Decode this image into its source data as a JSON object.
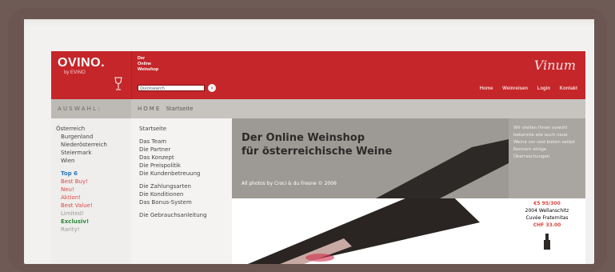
{
  "logo": {
    "main": "OVINO.",
    "sub": "by EVINO"
  },
  "tagline": [
    "Der",
    "Online",
    "Weinshop"
  ],
  "search": {
    "placeholder": "Quicksearch"
  },
  "script_logo": "Vinum",
  "nav": [
    "Home",
    "Weinreisen",
    "Login",
    "Kontakt"
  ],
  "selection_bar": {
    "left": "AUSWAHL:",
    "home": "HOME",
    "current": "Startseite"
  },
  "left_menu": {
    "items": [
      {
        "label": "Österreich",
        "level": 0,
        "style": "normal"
      },
      {
        "label": "Burgenland",
        "level": 1,
        "style": "normal"
      },
      {
        "label": "Niederösterreich",
        "level": 1,
        "style": "normal"
      },
      {
        "label": "Steiermark",
        "level": 1,
        "style": "normal"
      },
      {
        "label": "Wien",
        "level": 1,
        "style": "normal"
      },
      {
        "label": "Top 6",
        "level": 1,
        "style": "blue"
      },
      {
        "label": "Best Buy!",
        "level": 1,
        "style": "red"
      },
      {
        "label": "Neu!",
        "level": 1,
        "style": "red"
      },
      {
        "label": "Aktion!",
        "level": 1,
        "style": "red"
      },
      {
        "label": "Best Value!",
        "level": 1,
        "style": "red"
      },
      {
        "label": "Limited!",
        "level": 1,
        "style": "grey"
      },
      {
        "label": "Exclusiv!",
        "level": 1,
        "style": "green"
      },
      {
        "label": "Rarity!",
        "level": 1,
        "style": "grey"
      }
    ]
  },
  "mid_menu": [
    "Startseite",
    "",
    "Das Team",
    "Die Partner",
    "Das Konzept",
    "Die Preispolitik",
    "Die Kundenbetreuung",
    "",
    "Die Zahlungsarten",
    "Die Konditionen",
    "Das Bonus-System",
    "",
    "Die Gebrauchsanleitung"
  ],
  "banner": {
    "title_line1": "Der Online Weinshop",
    "title_line2": "für österreichische Weine",
    "credit": "All photos by Croci & du Fresne © 2006"
  },
  "side_text": "Wir stellen Ihnen sowohl bekannte wie auch neue Weine vor und bieten selbst Kennern einige Überraschungen",
  "offer": {
    "price_old": "€5 95/300",
    "name_line1": "2004 Wellanschitz",
    "name_line2": "Cuvée Fraternitas",
    "price_new": "CHF 33.00"
  },
  "colors": {
    "brand_red": "#c4262a",
    "bar_grey": "#c7c4bf",
    "banner_grey": "#9d9a96"
  }
}
